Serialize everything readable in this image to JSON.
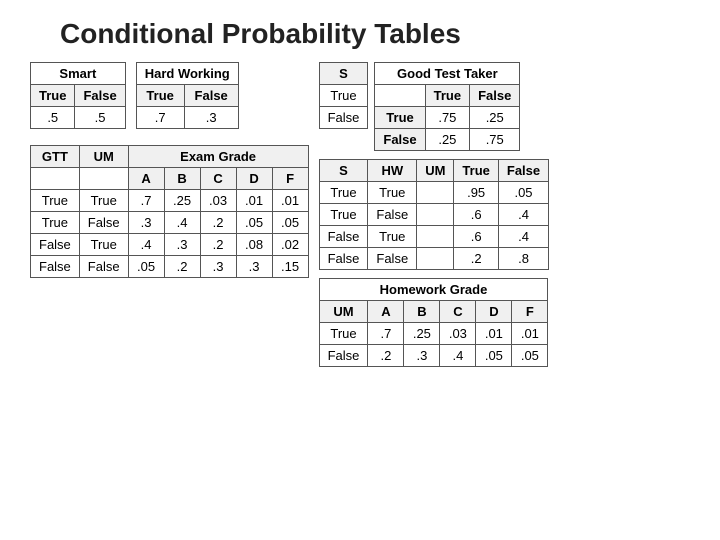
{
  "title": "Conditional Probability Tables",
  "smart_table": {
    "label": "Smart",
    "headers": [
      "True",
      "False"
    ],
    "values": [
      ".5",
      ".5"
    ]
  },
  "hard_working_table": {
    "label": "Hard Working",
    "headers": [
      "True",
      "False"
    ],
    "values": [
      ".7",
      ".3"
    ]
  },
  "s_column": {
    "label": "S",
    "rows": [
      "True",
      "False"
    ]
  },
  "good_test_taker_table": {
    "label": "Good Test Taker",
    "headers": [
      "True",
      "False"
    ],
    "rows": [
      {
        "label": "True",
        "values": [
          ".75",
          ".25"
        ]
      },
      {
        "label": "False",
        "values": [
          ".25",
          ".75"
        ]
      }
    ]
  },
  "gtt_um_table": {
    "col_headers": [
      "GTT",
      "UM",
      "Exam Grade",
      "",
      "",
      "",
      ""
    ],
    "sub_headers": [
      "",
      "",
      "A",
      "B",
      "C",
      "D",
      "F"
    ],
    "rows": [
      [
        "True",
        "True",
        ".7",
        ".25",
        ".03",
        ".01",
        ".01"
      ],
      [
        "True",
        "False",
        ".3",
        ".4",
        ".2",
        ".05",
        ".05"
      ],
      [
        "False",
        "True",
        ".4",
        ".3",
        ".2",
        ".08",
        ".02"
      ],
      [
        "False",
        "False",
        ".05",
        ".2",
        ".3",
        ".3",
        ".15"
      ]
    ]
  },
  "overlap_labels": {
    "s": "S",
    "hw": "HW",
    "um": "UM"
  },
  "overlap_table": {
    "headers": [
      "True",
      "False"
    ],
    "rows": [
      {
        "labels": [
          "True",
          "True"
        ],
        "values": [
          ".95",
          ".05"
        ]
      },
      {
        "labels": [
          "True",
          "False"
        ],
        "values": [
          ".6",
          ".4"
        ]
      },
      {
        "labels": [
          "False",
          "True"
        ],
        "values": [
          ".6",
          ".4"
        ]
      },
      {
        "labels": [
          "False",
          "False"
        ],
        "values": [
          ".2",
          ".8"
        ]
      }
    ]
  },
  "homework_grade_table": {
    "label": "Homework Grade",
    "col_headers": [
      "UM",
      "A",
      "B",
      "C",
      "D",
      "F"
    ],
    "rows": [
      [
        "True",
        ".7",
        ".25",
        ".03",
        ".01",
        ".01"
      ],
      [
        "False",
        ".2",
        ".3",
        ".4",
        ".05",
        ".05"
      ]
    ]
  }
}
